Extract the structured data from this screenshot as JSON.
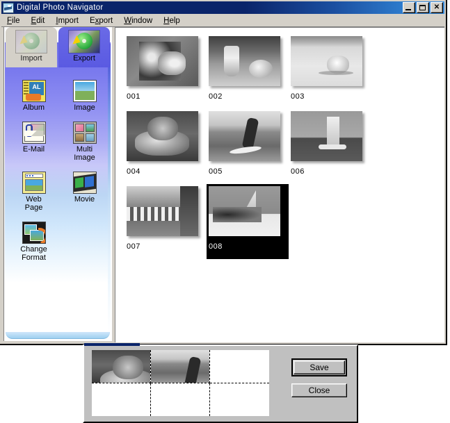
{
  "window": {
    "title": "Digital Photo Navigator",
    "title_icon": "camera-icon",
    "buttons": {
      "minimize": "minimize-icon",
      "maximize": "maximize-icon",
      "close": "close-icon"
    }
  },
  "menubar": {
    "items": [
      {
        "label": "File",
        "mnemonic": "F"
      },
      {
        "label": "Edit",
        "mnemonic": "E"
      },
      {
        "label": "Import",
        "mnemonic": "I"
      },
      {
        "label": "Export",
        "mnemonic": "E"
      },
      {
        "label": "Window",
        "mnemonic": "W"
      },
      {
        "label": "Help",
        "mnemonic": "H"
      }
    ]
  },
  "sidebar": {
    "tabs": [
      {
        "label": "Import",
        "icon": "disc-import-icon",
        "active": false
      },
      {
        "label": "Export",
        "icon": "disc-export-icon",
        "active": true
      }
    ],
    "items": [
      {
        "label": "Album",
        "icon": "album-icon"
      },
      {
        "label": "Image",
        "icon": "image-icon"
      },
      {
        "label": "E-Mail",
        "icon": "email-icon"
      },
      {
        "label": "Multi\nImage",
        "icon": "multi-image-icon"
      },
      {
        "label": "Web\nPage",
        "icon": "web-page-icon"
      },
      {
        "label": "Movie",
        "icon": "movie-icon"
      },
      {
        "label": "Change\nFormat",
        "icon": "change-format-icon"
      }
    ]
  },
  "thumbnails": [
    {
      "label": "001",
      "art": "ph-001",
      "selected": false
    },
    {
      "label": "002",
      "art": "ph-002",
      "selected": false
    },
    {
      "label": "003",
      "art": "ph-003",
      "selected": false
    },
    {
      "label": "004",
      "art": "ph-004",
      "selected": false
    },
    {
      "label": "005",
      "art": "ph-005",
      "selected": false
    },
    {
      "label": "006",
      "art": "ph-006",
      "selected": false
    },
    {
      "label": "007",
      "art": "ph-007",
      "selected": false
    },
    {
      "label": "008",
      "art": "ph-008",
      "selected": true
    }
  ],
  "dialog": {
    "cells": [
      {
        "filled": true,
        "art": "ph-004"
      },
      {
        "filled": true,
        "art": "ph-005"
      },
      {
        "filled": false,
        "art": ""
      },
      {
        "filled": false,
        "art": ""
      },
      {
        "filled": false,
        "art": ""
      },
      {
        "filled": false,
        "art": ""
      }
    ],
    "save_label": "Save",
    "close_label": "Close"
  },
  "colors": {
    "title_bar_start": "#0a246a",
    "title_bar_end": "#3b8fe0",
    "face": "#d4d0c8",
    "dialog_face": "#c0c0c0",
    "sidebar_top": "#6f6fe8",
    "selected_thumb_bg": "#000000"
  }
}
